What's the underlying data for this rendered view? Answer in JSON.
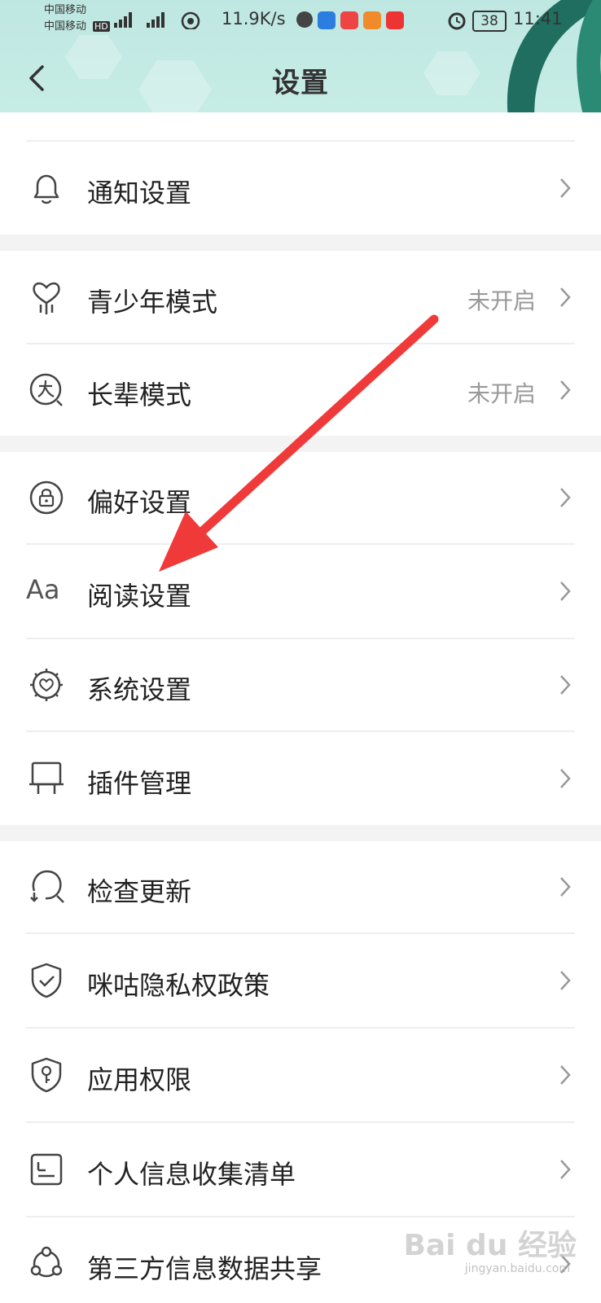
{
  "status_bar": {
    "carrier1": "中国移动",
    "carrier2": "中国移动",
    "speed": "11.9K/s",
    "battery": "38",
    "time": "11:41"
  },
  "header": {
    "title": "设置"
  },
  "items": [
    {
      "label": "通知设置",
      "icon": "bell-icon",
      "value": ""
    },
    {
      "label": "青少年模式",
      "icon": "heart-sprout-icon",
      "value": "未开启"
    },
    {
      "label": "长辈模式",
      "icon": "elder-icon",
      "value": "未开启"
    },
    {
      "label": "偏好设置",
      "icon": "lock-circle-icon",
      "value": ""
    },
    {
      "label": "阅读设置",
      "icon": "font-aa-icon",
      "value": "",
      "icon_text": "Aa"
    },
    {
      "label": "系统设置",
      "icon": "gear-heart-icon",
      "value": ""
    },
    {
      "label": "插件管理",
      "icon": "plugin-icon",
      "value": ""
    },
    {
      "label": "检查更新",
      "icon": "update-icon",
      "value": ""
    },
    {
      "label": "咪咕隐私权政策",
      "icon": "shield-check-icon",
      "value": ""
    },
    {
      "label": "应用权限",
      "icon": "shield-key-icon",
      "value": ""
    },
    {
      "label": "个人信息收集清单",
      "icon": "id-card-icon",
      "value": ""
    },
    {
      "label": "第三方信息数据共享",
      "icon": "share-nodes-icon",
      "value": ""
    }
  ],
  "watermark": {
    "text": "Bai du 经验",
    "sub": "jingyan.baidu.com"
  },
  "colors": {
    "header_bg": "#c4eae4",
    "arrow": "#f03a3a",
    "section_gap": "#f3f3f3"
  }
}
